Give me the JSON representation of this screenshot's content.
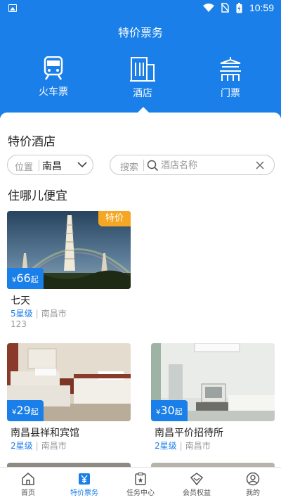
{
  "status_bar": {
    "time": "10:59"
  },
  "app_title": "特价票务",
  "categories": [
    {
      "label": "火车票",
      "icon": "train-icon"
    },
    {
      "label": "酒店",
      "icon": "hotel-icon",
      "active": true
    },
    {
      "label": "门票",
      "icon": "ticket-gate-icon"
    }
  ],
  "section_title": "特价酒店",
  "filter": {
    "location_label": "位置",
    "location_value": "南昌",
    "search_label": "搜索",
    "search_placeholder": "酒店名称"
  },
  "list_title": "住哪儿便宜",
  "price_currency": "¥",
  "price_suffix": "起",
  "hotels": [
    {
      "name": "七天",
      "price": "66",
      "star": "5星级",
      "city": "南昌市",
      "desc": "123",
      "tag": "特价"
    },
    {
      "name": "南昌县祥和宾馆",
      "price": "29",
      "star": "2星级",
      "city": "南昌市"
    },
    {
      "name": "南昌平价招待所",
      "price": "30",
      "star": "2星级",
      "city": "南昌市"
    }
  ],
  "tabbar": [
    {
      "label": "首页",
      "icon": "home-icon"
    },
    {
      "label": "特价票务",
      "icon": "yen-ticket-icon",
      "active": true
    },
    {
      "label": "任务中心",
      "icon": "task-icon"
    },
    {
      "label": "会员权益",
      "icon": "diamond-icon"
    },
    {
      "label": "我的",
      "icon": "profile-icon"
    }
  ],
  "colors": {
    "primary": "#1a7fe8",
    "tag": "#f5a623"
  }
}
